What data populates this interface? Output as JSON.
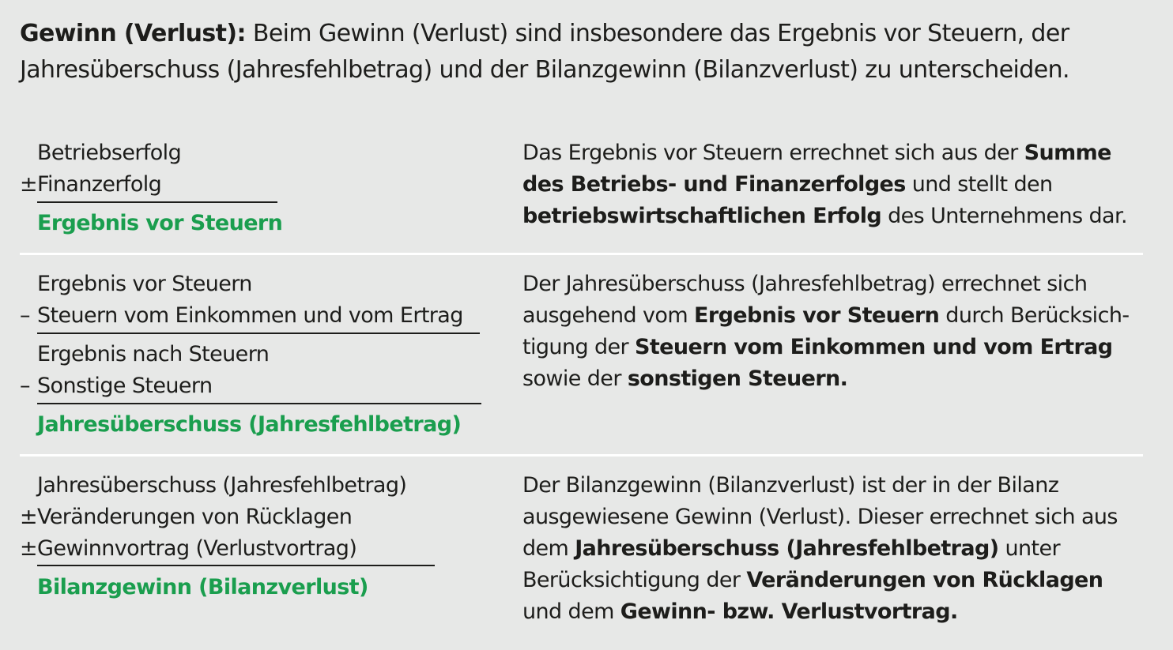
{
  "intro": {
    "term": "Gewinn (Verlust):",
    "text": " Beim Gewinn (Verlust) sind insbesondere das Ergebnis vor Steuern, der Jahresüberschuss (Jahresfehlbetrag) und der Bilanzgewinn (Bilanzverlust) zu unterscheiden."
  },
  "sections": [
    {
      "lines": [
        {
          "op": "",
          "label": "Betriebserfolg"
        },
        {
          "op": "±",
          "label": "Finanzerfolg"
        }
      ],
      "result": "Ergebnis vor Steuern",
      "desc": [
        {
          "t": "Das Ergebnis vor Steuern errechnet sich aus der "
        },
        {
          "b": "Summe des Betriebs- und Finanzerfolges"
        },
        {
          "t": " und stellt den "
        },
        {
          "b": "betriebswirtschaftlichen Erfolg"
        },
        {
          "t": " des Unternehmens dar."
        }
      ]
    },
    {
      "lines": [
        {
          "op": "",
          "label": "Ergebnis vor Steuern"
        },
        {
          "op": "–",
          "label": "Steuern vom Einkommen und vom Ertrag"
        },
        {
          "op": "",
          "label": "Ergebnis nach Steuern"
        },
        {
          "op": "–",
          "label": "Sonstige Steuern"
        }
      ],
      "result": "Jahresüberschuss (Jahresfehlbetrag)",
      "desc": [
        {
          "t": "Der Jahresüberschuss (Jahresfehlbetrag) errechnet sich ausgehend vom "
        },
        {
          "b": "Ergebnis vor Steuern"
        },
        {
          "t": " durch Berücksich­tigung der "
        },
        {
          "b": "Steuern vom Einkommen und vom Ertrag"
        },
        {
          "t": " sowie der "
        },
        {
          "b": "sonstigen Steuern."
        }
      ]
    },
    {
      "lines": [
        {
          "op": "",
          "label": "Jahresüberschuss (Jahresfehlbetrag)"
        },
        {
          "op": "±",
          "label": "Veränderungen von Rücklagen"
        },
        {
          "op": "±",
          "label": "Gewinnvortrag (Verlustvortrag)"
        }
      ],
      "result": "Bilanzgewinn (Bilanzverlust)",
      "desc": [
        {
          "t": "Der Bilanzgewinn (Bilanzverlust) ist der in der Bilanz ausgewiesene Gewinn (Verlust). Dieser errechnet sich aus dem "
        },
        {
          "b": "Jahresüberschuss (Jahresfehlbetrag)"
        },
        {
          "t": " unter Berücksichtigung der "
        },
        {
          "b": "Veränderungen von Rücklagen"
        },
        {
          "t": " und dem "
        },
        {
          "b": "Gewinn- bzw. Verlustvortrag."
        }
      ]
    }
  ]
}
